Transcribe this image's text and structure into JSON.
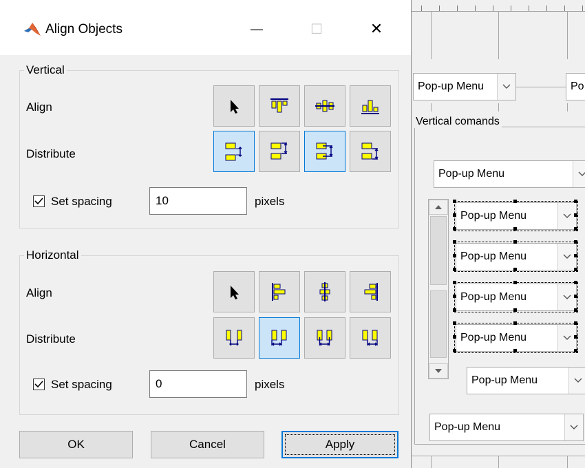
{
  "window": {
    "title": "Align Objects",
    "controls": {
      "minimize": "—",
      "maximize": "☐",
      "close": "✕"
    }
  },
  "vertical": {
    "group_label": "Vertical",
    "align_label": "Align",
    "distribute_label": "Distribute",
    "align_buttons": [
      "select-arrow",
      "align-top",
      "align-middle",
      "align-bottom"
    ],
    "distribute_buttons": [
      "distribute-edge-gap",
      "distribute-top",
      "distribute-middle",
      "distribute-bottom"
    ],
    "selected_distribute": "distribute-middle",
    "set_spacing_label": "Set spacing",
    "set_spacing_checked": true,
    "spacing_value": "10",
    "units_label": "pixels"
  },
  "horizontal": {
    "group_label": "Horizontal",
    "align_label": "Align",
    "distribute_label": "Distribute",
    "align_buttons": [
      "select-arrow",
      "align-left",
      "align-center",
      "align-right"
    ],
    "distribute_buttons": [
      "distribute-edge-gap",
      "distribute-left",
      "distribute-center",
      "distribute-right"
    ],
    "selected_distribute": "distribute-left",
    "set_spacing_label": "Set spacing",
    "set_spacing_checked": true,
    "spacing_value": "0",
    "units_label": "pixels"
  },
  "buttons": {
    "ok": "OK",
    "cancel": "Cancel",
    "apply": "Apply"
  },
  "canvas": {
    "popup_label": "Pop-up Menu",
    "popup_label_cut": "Po",
    "group_label": "Vertical comands",
    "popup_count": 8
  },
  "colors": {
    "icon_fill": "#ffff00",
    "icon_stroke": "#000080",
    "selected_bg": "#cce4f7",
    "selected_border": "#0078d7"
  }
}
